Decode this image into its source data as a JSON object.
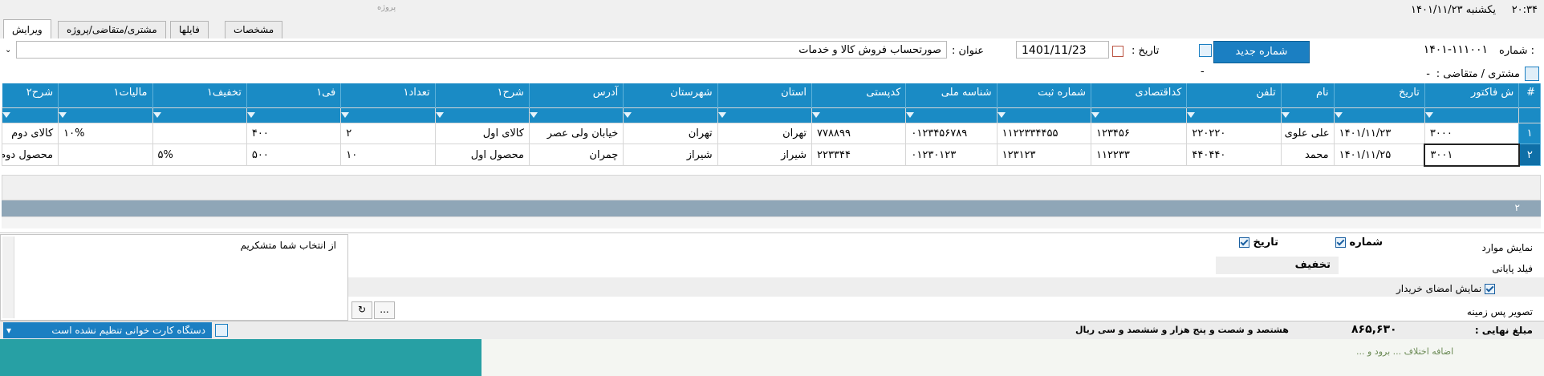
{
  "topbar": {
    "clock": "۲۰:۳۴",
    "day_date": "یکشنبه  ۱۴۰۱/۱۱/۲۳",
    "faded": "پروژه"
  },
  "tabs": [
    "ویرایش",
    "مشتری/متقاضی/پروژه",
    "فایلها",
    "مشخصات"
  ],
  "form": {
    "number_label": "شماره :",
    "number_value": "۱۴۰۱-۱۱۱۰۰۱",
    "new_number_btn": "شماره جدید",
    "date_label": "تاریخ :",
    "date_value": "1401/11/23",
    "title_label": "عنوان :",
    "title_value": "صورتحساب فروش کالا و خدمات",
    "customer_label": "مشتری / متقاضی :",
    "customer_value": "-",
    "extra_dash": "-"
  },
  "grid": {
    "columns": [
      "#",
      "ش فاکتور",
      "تاریخ",
      "نام",
      "تلفن",
      "کداقتصادی",
      "شماره ثبت",
      "شناسه ملی",
      "کدپستی",
      "استان",
      "شهرستان",
      "آدرس",
      "شرح۱",
      "تعداد۱",
      "فی۱",
      "تخفیف۱",
      "مالیات۱",
      "شرح۲"
    ],
    "rows": [
      [
        "۱",
        "۳۰۰۰",
        "۱۴۰۱/۱۱/۲۳",
        "علی علوی",
        "۲۲۰۲۲۰",
        "۱۲۳۴۵۶",
        "۱۱۲۲۳۳۴۴۵۵",
        "۰۱۲۳۴۵۶۷۸۹",
        "۷۷۸۸۹۹",
        "تهران",
        "تهران",
        "خیابان ولی عصر",
        "کالای اول",
        "۲",
        "۴۰۰",
        "",
        "۱۰%",
        "کالای دوم"
      ],
      [
        "۲",
        "۳۰۰۱",
        "۱۴۰۱/۱۱/۲۵",
        "محمد",
        "۴۴۰۴۴۰",
        "۱۱۲۲۳۳",
        "۱۲۳۱۲۳",
        "۰۱۲۳۰۱۲۳",
        "۲۲۳۳۴۴",
        "شیراز",
        "شیراز",
        "چمران",
        "محصول اول",
        "۱۰",
        "۵۰۰",
        "۵%",
        "",
        "محصول دوم"
      ]
    ],
    "row_count": "۲"
  },
  "options": {
    "show_items_label": "نمایش موارد",
    "chk_number": "شماره",
    "chk_date": "تاریخ",
    "footer_field_label": "فیلد پایانی",
    "footer_field_value": "تخفیف",
    "buyer_sig_label": "نمایش امضای خریدار",
    "bg_image_label": "تصویر پس زمینه",
    "more_btn": "..."
  },
  "thanks_text": "از انتخاب شما متشکریم",
  "totals": {
    "final_label": "مبلغ نهایی :",
    "final_value": "۸۶۵,۶۳۰",
    "in_words": "هشتصد و شصت و پنج هزار و ششصد و سی ریال"
  },
  "status": {
    "card_reader": "دستگاه کارت خوانی تنظیم نشده است"
  },
  "footnote": "اضافه اختلاف ... برود و ..."
}
